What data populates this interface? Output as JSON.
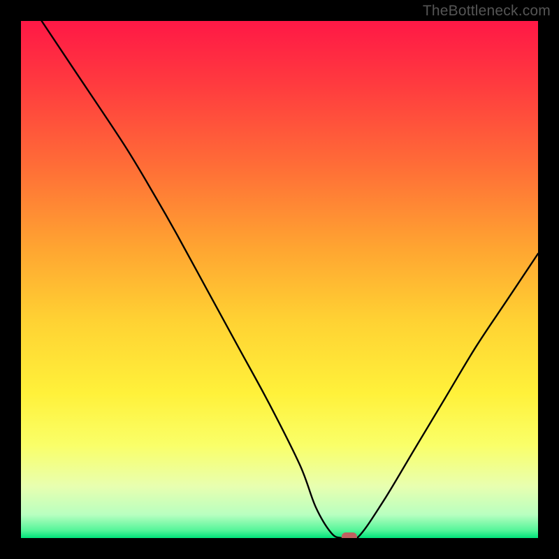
{
  "watermark": "TheBottleneck.com",
  "chart_data": {
    "type": "line",
    "title": "",
    "xlabel": "",
    "ylabel": "",
    "xlim": [
      0,
      100
    ],
    "ylim": [
      0,
      100
    ],
    "series": [
      {
        "name": "curve",
        "x": [
          4,
          10,
          20,
          26,
          30,
          36,
          42,
          48,
          54,
          57,
          60,
          62,
          65,
          70,
          76,
          82,
          88,
          94,
          100
        ],
        "y": [
          100,
          91,
          76,
          66,
          59,
          48,
          37,
          26,
          14,
          6,
          1,
          0,
          0,
          7,
          17,
          27,
          37,
          46,
          55
        ]
      }
    ],
    "marker": {
      "x": 63.5,
      "y": 0,
      "color": "#c06060"
    },
    "gradient_stops": [
      {
        "offset": 0.0,
        "color": "#ff1846"
      },
      {
        "offset": 0.12,
        "color": "#ff3a3f"
      },
      {
        "offset": 0.28,
        "color": "#ff6d37"
      },
      {
        "offset": 0.44,
        "color": "#ffa531"
      },
      {
        "offset": 0.58,
        "color": "#ffd233"
      },
      {
        "offset": 0.72,
        "color": "#fff13a"
      },
      {
        "offset": 0.82,
        "color": "#faff68"
      },
      {
        "offset": 0.9,
        "color": "#e8ffb0"
      },
      {
        "offset": 0.955,
        "color": "#b8ffc0"
      },
      {
        "offset": 0.985,
        "color": "#55f59a"
      },
      {
        "offset": 1.0,
        "color": "#00e27a"
      }
    ]
  }
}
